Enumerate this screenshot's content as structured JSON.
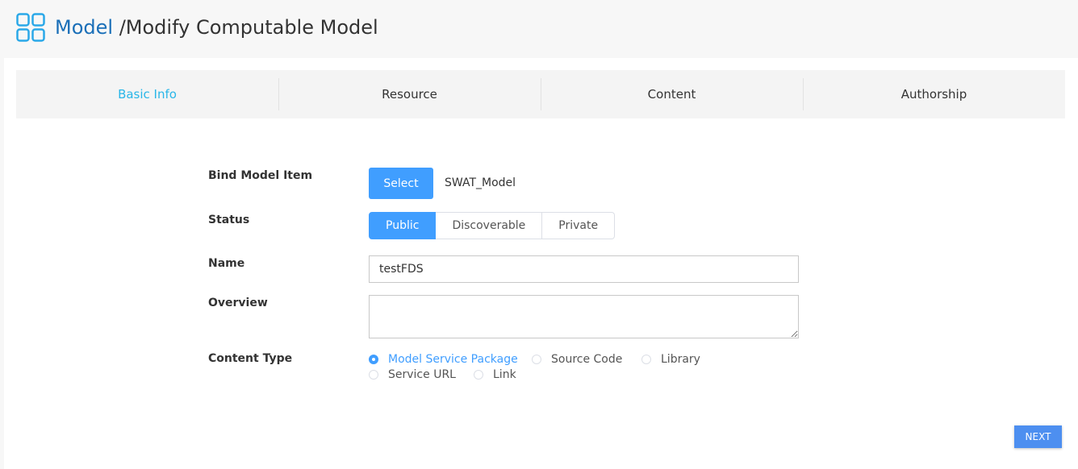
{
  "header": {
    "title_main": "Model",
    "title_rest": "/Modify Computable Model",
    "icon": "grid-icon"
  },
  "steps": [
    {
      "label": "Basic Info",
      "active": true
    },
    {
      "label": "Resource",
      "active": false
    },
    {
      "label": "Content",
      "active": false
    },
    {
      "label": "Authorship",
      "active": false
    }
  ],
  "form": {
    "bind_model_item": {
      "label": "Bind Model Item",
      "button": "Select",
      "value": "SWAT_Model"
    },
    "status": {
      "label": "Status",
      "options": [
        "Public",
        "Discoverable",
        "Private"
      ],
      "selected": "Public"
    },
    "name": {
      "label": "Name",
      "value": "testFDS"
    },
    "overview": {
      "label": "Overview",
      "value": ""
    },
    "content_type": {
      "label": "Content Type",
      "options": [
        "Model Service Package",
        "Source Code",
        "Library",
        "Service URL",
        "Link"
      ],
      "selected": "Model Service Package"
    }
  },
  "actions": {
    "next_label": "NEXT"
  },
  "colors": {
    "accent": "#409eff",
    "active_step": "#29b6e8",
    "title_blue": "#1a6fb8"
  }
}
